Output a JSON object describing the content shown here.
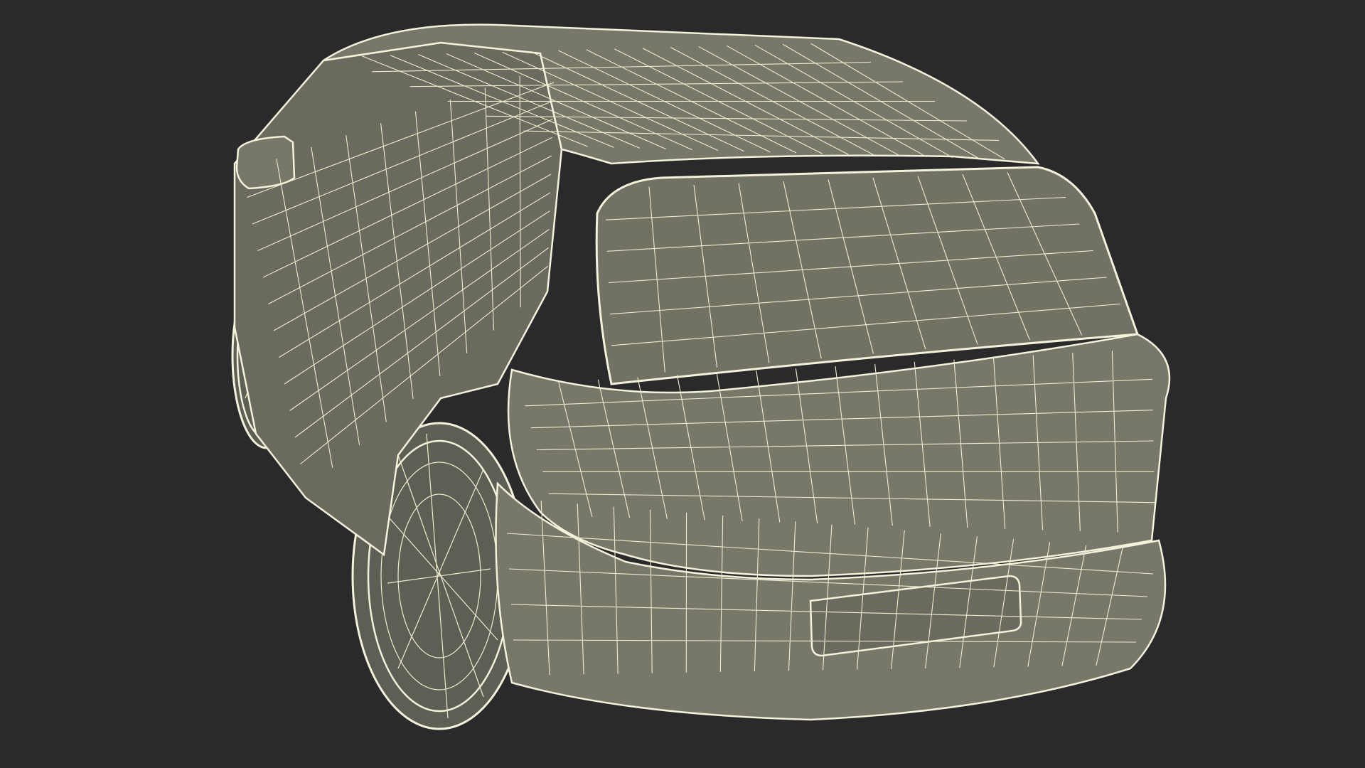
{
  "scene": {
    "subject": "wireframe-suv-rear-three-quarter",
    "colors": {
      "background": "#2a2a2a",
      "surface": "#77786a",
      "surface_dark": "#6a6b5e",
      "glass": "#717264",
      "tire": "#5e5f54",
      "wire": "#efecd2",
      "wire_dense": "#f4f1dc"
    }
  },
  "parts": [
    {
      "name": "near-rear-tire-icon",
      "kind": "tire"
    },
    {
      "name": "far-rear-tire-icon",
      "kind": "tire"
    },
    {
      "name": "body-side-panel-icon",
      "kind": "panel"
    },
    {
      "name": "roof-panel-icon",
      "kind": "panel"
    },
    {
      "name": "rear-window-icon",
      "kind": "glass"
    },
    {
      "name": "tailgate-panel-icon",
      "kind": "panel"
    },
    {
      "name": "rear-bumper-icon",
      "kind": "panel"
    },
    {
      "name": "license-plate-icon",
      "kind": "panel"
    },
    {
      "name": "side-mirror-icon",
      "kind": "panel"
    }
  ]
}
